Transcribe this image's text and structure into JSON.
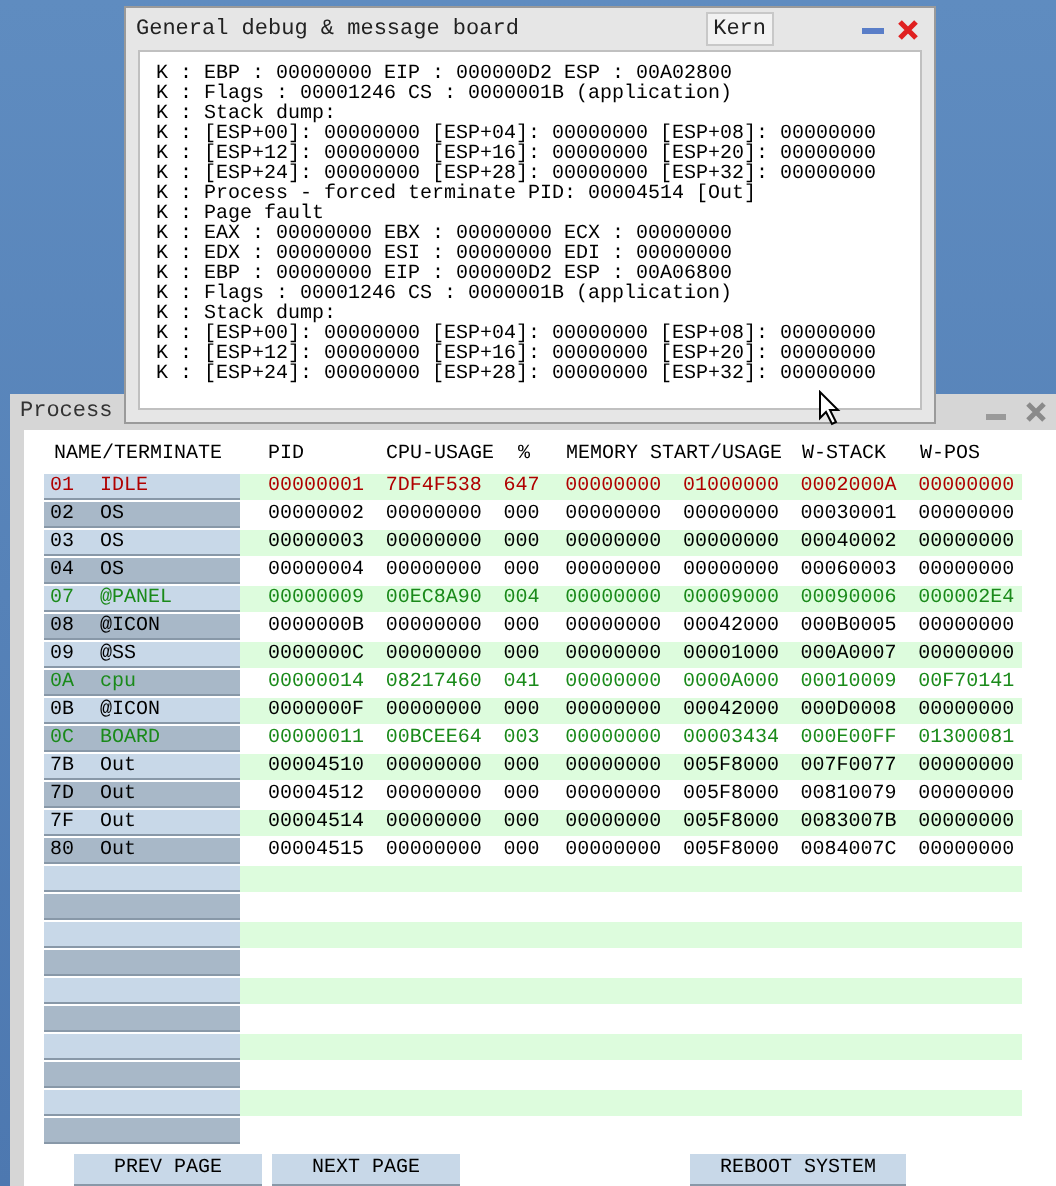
{
  "debug_window": {
    "title": "General debug & message board",
    "kern_button": "Kern",
    "lines": [
      "K : EBP : 00000000 EIP : 000000D2 ESP : 00A02800",
      "K : Flags : 00001246 CS : 0000001B (application)",
      "K : Stack dump:",
      "K : [ESP+00]: 00000000 [ESP+04]: 00000000 [ESP+08]: 00000000",
      "K : [ESP+12]: 00000000 [ESP+16]: 00000000 [ESP+20]: 00000000",
      "K : [ESP+24]: 00000000 [ESP+28]: 00000000 [ESP+32]: 00000000",
      "K : Process - forced terminate PID: 00004514 [Out]",
      "K : Page fault",
      "K : EAX : 00000000 EBX : 00000000 ECX : 00000000",
      "K : EDX : 00000000 ESI : 00000000 EDI : 00000000",
      "K : EBP : 00000000 EIP : 000000D2 ESP : 00A06800",
      "K : Flags : 00001246 CS : 0000001B (application)",
      "K : Stack dump:",
      "K : [ESP+00]: 00000000 [ESP+04]: 00000000 [ESP+08]: 00000000",
      "K : [ESP+12]: 00000000 [ESP+16]: 00000000 [ESP+20]: 00000000",
      "K : [ESP+24]: 00000000 [ESP+28]: 00000000 [ESP+32]: 00000000"
    ]
  },
  "process_window": {
    "title": "Process",
    "columns": [
      "NAME/TERMINATE",
      "",
      "PID",
      "CPU-USAGE",
      "%",
      "MEMORY START/USAGE",
      "",
      "W-STACK",
      "W-POS"
    ],
    "rows": [
      {
        "color": "#b00000",
        "cells": [
          "01",
          "IDLE",
          "00000001",
          "7DF4F538",
          "647",
          "00000000",
          "01000000",
          "0002000A",
          "00000000"
        ]
      },
      {
        "color": "#000000",
        "cells": [
          "02",
          "OS",
          "00000002",
          "00000000",
          "000",
          "00000000",
          "00000000",
          "00030001",
          "00000000"
        ]
      },
      {
        "color": "#000000",
        "cells": [
          "03",
          "OS",
          "00000003",
          "00000000",
          "000",
          "00000000",
          "00000000",
          "00040002",
          "00000000"
        ]
      },
      {
        "color": "#000000",
        "cells": [
          "04",
          "OS",
          "00000004",
          "00000000",
          "000",
          "00000000",
          "00000000",
          "00060003",
          "00000000"
        ]
      },
      {
        "color": "#1a8a1a",
        "cells": [
          "07",
          "@PANEL",
          "00000009",
          "00EC8A90",
          "004",
          "00000000",
          "00009000",
          "00090006",
          "000002E4"
        ]
      },
      {
        "color": "#000000",
        "cells": [
          "08",
          "@ICON",
          "0000000B",
          "00000000",
          "000",
          "00000000",
          "00042000",
          "000B0005",
          "00000000"
        ]
      },
      {
        "color": "#000000",
        "cells": [
          "09",
          "@SS",
          "0000000C",
          "00000000",
          "000",
          "00000000",
          "00001000",
          "000A0007",
          "00000000"
        ]
      },
      {
        "color": "#1a8a1a",
        "cells": [
          "0A",
          "cpu",
          "00000014",
          "08217460",
          "041",
          "00000000",
          "0000A000",
          "00010009",
          "00F70141"
        ]
      },
      {
        "color": "#000000",
        "cells": [
          "0B",
          "@ICON",
          "0000000F",
          "00000000",
          "000",
          "00000000",
          "00042000",
          "000D0008",
          "00000000"
        ]
      },
      {
        "color": "#1a8a1a",
        "cells": [
          "0C",
          "BOARD",
          "00000011",
          "00BCEE64",
          "003",
          "00000000",
          "00003434",
          "000E00FF",
          "01300081"
        ]
      },
      {
        "color": "#000000",
        "cells": [
          "7B",
          "Out",
          "00004510",
          "00000000",
          "000",
          "00000000",
          "005F8000",
          "007F0077",
          "00000000"
        ]
      },
      {
        "color": "#000000",
        "cells": [
          "7D",
          "Out",
          "00004512",
          "00000000",
          "000",
          "00000000",
          "005F8000",
          "00810079",
          "00000000"
        ]
      },
      {
        "color": "#000000",
        "cells": [
          "7F",
          "Out",
          "00004514",
          "00000000",
          "000",
          "00000000",
          "005F8000",
          "0083007B",
          "00000000"
        ]
      },
      {
        "color": "#000000",
        "cells": [
          "80",
          "Out",
          "00004515",
          "00000000",
          "000",
          "00000000",
          "005F8000",
          "0084007C",
          "00000000"
        ]
      }
    ],
    "buttons": [
      "PREV PAGE",
      "NEXT PAGE",
      "REBOOT SYSTEM"
    ]
  }
}
